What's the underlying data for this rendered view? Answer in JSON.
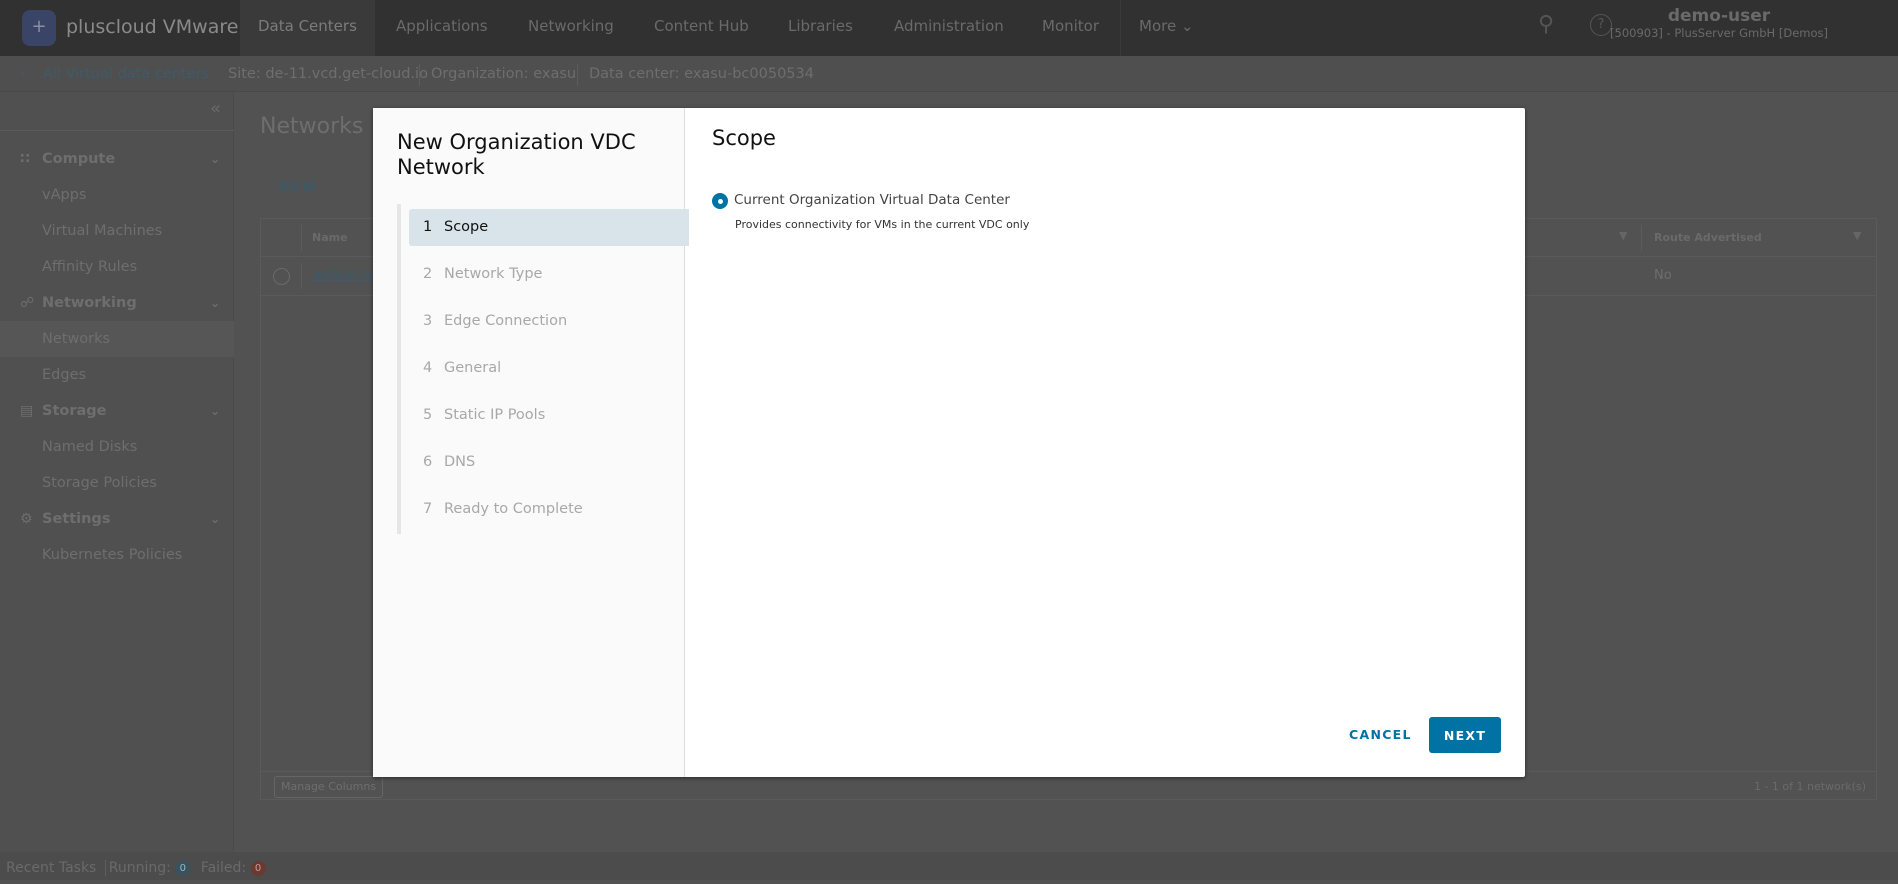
{
  "header": {
    "brand": "pluscloud VMware",
    "nav": [
      "Data Centers",
      "Applications",
      "Networking",
      "Content Hub",
      "Libraries",
      "Administration",
      "Monitor",
      "More"
    ],
    "active_nav": "Data Centers",
    "user_name": "demo-user",
    "user_org": "[500903] - PlusServer GmbH [Demos]"
  },
  "subheader": {
    "back_link": "All Virtual data centers",
    "site": "Site: de-11.vcd.get-cloud.io",
    "organization": "Organization: exasu",
    "data_center": "Data center: exasu-bc0050534"
  },
  "sidebar": {
    "groups": [
      {
        "label": "Compute",
        "icon": "grid-icon",
        "items": [
          "vApps",
          "Virtual Machines",
          "Affinity Rules"
        ]
      },
      {
        "label": "Networking",
        "icon": "network-icon",
        "items": [
          "Networks",
          "Edges"
        ]
      },
      {
        "label": "Storage",
        "icon": "database-icon",
        "items": [
          "Named Disks",
          "Storage Policies"
        ]
      },
      {
        "label": "Settings",
        "icon": "gear-icon",
        "items": [
          "Kubernetes Policies"
        ]
      }
    ],
    "selected": "Networks"
  },
  "main": {
    "title": "Networks",
    "new_label": "NEW",
    "columns": [
      "Name",
      "Route Advertised"
    ],
    "rows": [
      {
        "name": "default-ne",
        "route_advertised": "No"
      }
    ],
    "manage_columns": "Manage Columns",
    "pagination": "1 - 1 of 1 network(s)"
  },
  "tasks": {
    "label": "Recent Tasks",
    "running_label": "Running:",
    "running": "0",
    "failed_label": "Failed:",
    "failed": "0"
  },
  "modal": {
    "title": "New Organization VDC Network",
    "steps": [
      {
        "n": "1",
        "label": "Scope"
      },
      {
        "n": "2",
        "label": "Network Type"
      },
      {
        "n": "3",
        "label": "Edge Connection"
      },
      {
        "n": "4",
        "label": "General"
      },
      {
        "n": "5",
        "label": "Static IP Pools"
      },
      {
        "n": "6",
        "label": "DNS"
      },
      {
        "n": "7",
        "label": "Ready to Complete"
      }
    ],
    "active_step": 1,
    "section_title": "Scope",
    "option_label": "Current Organization Virtual Data Center",
    "option_desc": "Provides connectivity for VMs in the current VDC only",
    "option_selected": true,
    "cancel": "CANCEL",
    "next": "NEXT"
  },
  "colors": {
    "accent": "#0072a3",
    "active_step_bg": "#d9e4ea"
  }
}
